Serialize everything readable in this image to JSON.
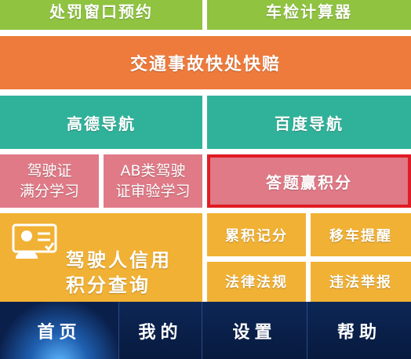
{
  "tiles": {
    "penalty_appointment": "处罚窗口预约",
    "inspection_calculator": "车检计算器",
    "accident_quick_claim": "交通事故快处快赔",
    "gaode_nav": "高德导航",
    "baidu_nav": "百度导航",
    "full_score_study": "驾驶证\n满分学习",
    "ab_license_study": "AB类驾驶\n证审验学习",
    "quiz_points": "答题赢积分",
    "credit_points_query": "驾驶人信用\n积分查询",
    "points_record": "累积记分",
    "move_car": "移车提醒",
    "laws": "法律法规",
    "violation_report": "违法举报"
  },
  "tabbar": {
    "home": "首页",
    "mine": "我的",
    "settings": "设置",
    "help": "帮助"
  },
  "colors": {
    "green": "#8fc340",
    "orange": "#ee7b3c",
    "teal": "#30b29a",
    "pink": "#e07a87",
    "yellow": "#f1b134",
    "highlight_border": "#e11b22",
    "tabbar_bg": "#0a1f4a",
    "active_tab_glow": "#5fb8ff"
  },
  "icons": {
    "credit_card": "id-card-person-icon"
  }
}
